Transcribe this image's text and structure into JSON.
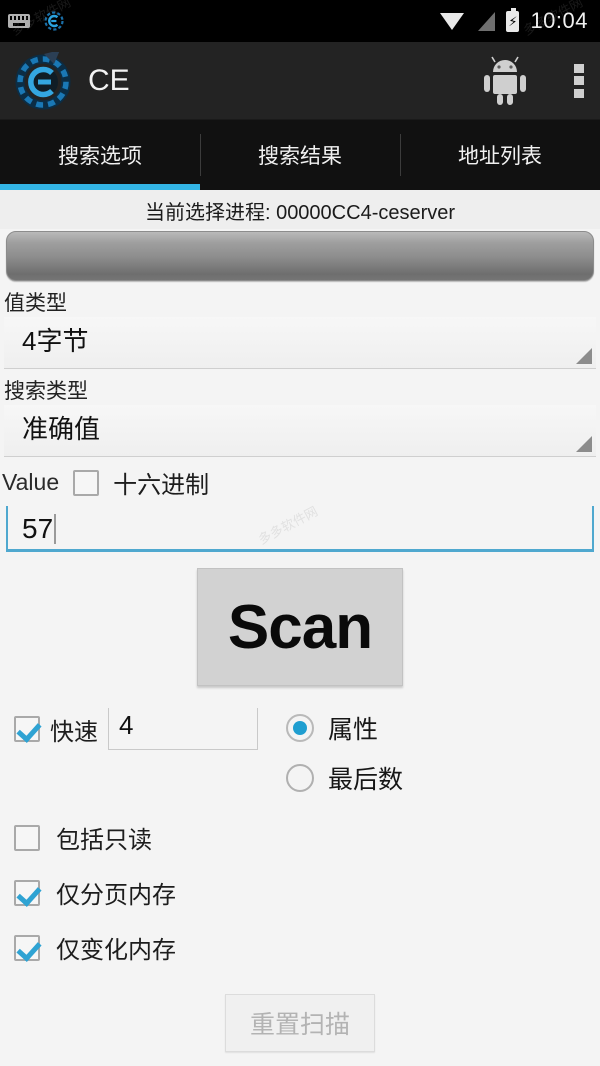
{
  "statusbar": {
    "icons": [
      "keyboard-icon",
      "cheat-engine-notification-icon",
      "wifi-icon",
      "signal-icon",
      "battery-charging-icon"
    ],
    "clock": "10:04"
  },
  "appbar": {
    "logo": "cheat-engine-logo",
    "title": "CE",
    "android_icon": "android-robot-icon",
    "overflow": "overflow-menu-icon"
  },
  "tabs": [
    {
      "label": "搜索选项",
      "active": true
    },
    {
      "label": "搜索结果",
      "active": false
    },
    {
      "label": "地址列表",
      "active": false
    }
  ],
  "process": {
    "label": "当前选择进程: 00000CC4-ceserver",
    "select_button": "process-select-bar"
  },
  "fields": {
    "value_type_label": "值类型",
    "value_type_value": "4字节",
    "scan_type_label": "搜索类型",
    "scan_type_value": "准确值",
    "value_label": "Value",
    "hex_label": "十六进制",
    "hex_checked": false,
    "value_text": "57"
  },
  "scan": {
    "label": "Scan"
  },
  "options": {
    "fast_label": "快速",
    "fast_checked": true,
    "fast_value": "4",
    "radios": [
      {
        "label": "属性",
        "selected": true
      },
      {
        "label": "最后数",
        "selected": false
      }
    ],
    "checkboxes": [
      {
        "label": "包括只读",
        "checked": false
      },
      {
        "label": "仅分页内存",
        "checked": true
      },
      {
        "label": "仅变化内存",
        "checked": true
      }
    ]
  },
  "footer": {
    "reset_label": "重置扫描",
    "reset_disabled": true
  },
  "colors": {
    "accent": "#33b5e5",
    "check": "#2fa3d3",
    "statusbar_bg": "#000000",
    "appbar_bg": "#232323",
    "content_bg": "#f4f4f4"
  }
}
